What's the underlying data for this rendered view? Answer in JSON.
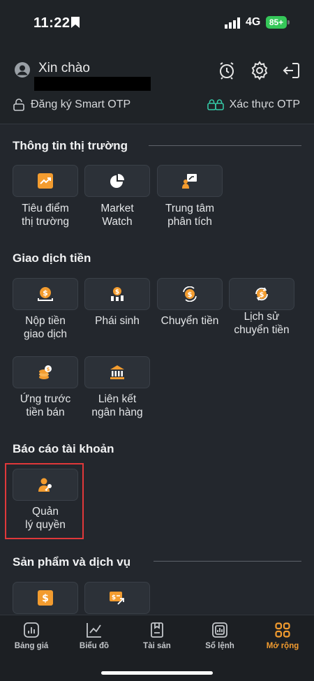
{
  "status_bar": {
    "time": "11:22",
    "network": "4G",
    "battery": "85+"
  },
  "header": {
    "greeting": "Xin chào",
    "smart_otp_register": "Đăng ký Smart OTP",
    "otp_verify": "Xác thực OTP"
  },
  "sections": {
    "market_info": {
      "title": "Thông tin thị trường",
      "items": [
        "Tiêu điểm\nthị trường",
        "Market\nWatch",
        "Trung tâm\nphân tích"
      ]
    },
    "money_transactions": {
      "title": "Giao dịch tiền",
      "items": [
        "Nộp tiền\ngiao dịch",
        "Phái sinh",
        "Chuyển tiền",
        "Lịch sử\nchuyển tiền",
        "Ứng trước\ntiền bán",
        "Liên kết\nngân hàng"
      ]
    },
    "account_report": {
      "title": "Báo cáo tài khoản",
      "items": [
        "Quản\nlý quyền"
      ]
    },
    "products_services": {
      "title": "Sản phẩm và dịch vụ"
    }
  },
  "tabs": [
    {
      "label": "Bảng giá",
      "icon": "price-board-icon"
    },
    {
      "label": "Biểu đồ",
      "icon": "chart-icon"
    },
    {
      "label": "Tài sản",
      "icon": "assets-icon"
    },
    {
      "label": "Sổ lệnh",
      "icon": "order-book-icon"
    },
    {
      "label": "Mở rộng",
      "icon": "expand-grid-icon",
      "active": true
    }
  ],
  "colors": {
    "accent": "#f39c2f",
    "background": "#23272d",
    "highlight": "#e0383a",
    "otp_icon": "#35c7a5"
  }
}
